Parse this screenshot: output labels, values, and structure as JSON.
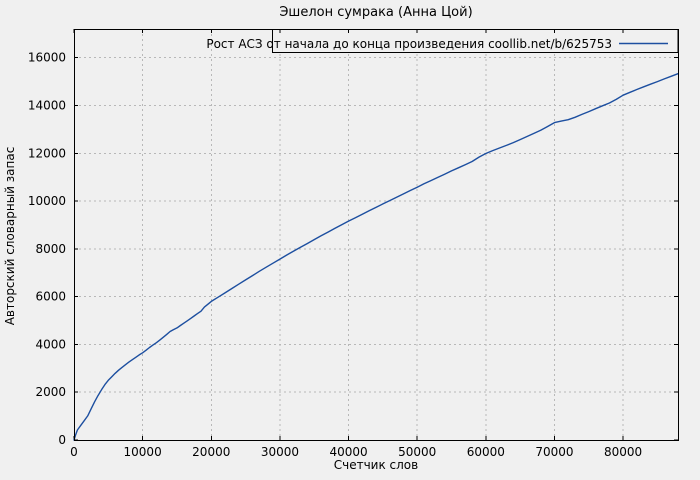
{
  "chart_data": {
    "type": "line",
    "title": "Эшелон сумрака (Анна Цой)",
    "xlabel": "Счетчик слов",
    "ylabel": "Авторский словарный запас",
    "legend": {
      "label": "Рост АСЗ от начала до конца произведения coollib.net/b/625753",
      "position": "top-right",
      "box": true
    },
    "grid": true,
    "xlim": [
      0,
      88000
    ],
    "ylim": [
      0,
      17200
    ],
    "xticks": [
      0,
      10000,
      20000,
      30000,
      40000,
      50000,
      60000,
      70000,
      80000
    ],
    "yticks": [
      0,
      2000,
      4000,
      6000,
      8000,
      10000,
      12000,
      14000,
      16000
    ],
    "colors": {
      "line": "#1d4fa0",
      "background": "#f0f0f0",
      "grid": "#b8b8b8",
      "border": "#000000",
      "text": "#000000"
    },
    "series": [
      {
        "name": "Рост АСЗ от начала до конца произведения coollib.net/b/625753",
        "color": "#1d4fa0",
        "points": [
          [
            0,
            0
          ],
          [
            200,
            190
          ],
          [
            500,
            420
          ],
          [
            1000,
            620
          ],
          [
            1500,
            810
          ],
          [
            2000,
            1010
          ],
          [
            2500,
            1310
          ],
          [
            3000,
            1600
          ],
          [
            3500,
            1860
          ],
          [
            4000,
            2100
          ],
          [
            4500,
            2320
          ],
          [
            5000,
            2500
          ],
          [
            5500,
            2650
          ],
          [
            6000,
            2790
          ],
          [
            6500,
            2920
          ],
          [
            7000,
            3040
          ],
          [
            7500,
            3150
          ],
          [
            8000,
            3260
          ],
          [
            8500,
            3360
          ],
          [
            9000,
            3460
          ],
          [
            9500,
            3560
          ],
          [
            10000,
            3650
          ],
          [
            10500,
            3760
          ],
          [
            11000,
            3870
          ],
          [
            11500,
            3970
          ],
          [
            12000,
            4070
          ],
          [
            12500,
            4180
          ],
          [
            13000,
            4300
          ],
          [
            13500,
            4420
          ],
          [
            14000,
            4540
          ],
          [
            14500,
            4620
          ],
          [
            15000,
            4690
          ],
          [
            15500,
            4790
          ],
          [
            16000,
            4890
          ],
          [
            16500,
            4990
          ],
          [
            17000,
            5090
          ],
          [
            17500,
            5190
          ],
          [
            18000,
            5290
          ],
          [
            18500,
            5390
          ],
          [
            19000,
            5560
          ],
          [
            19500,
            5680
          ],
          [
            20000,
            5800
          ],
          [
            21000,
            5975
          ],
          [
            22000,
            6155
          ],
          [
            23000,
            6340
          ],
          [
            24000,
            6520
          ],
          [
            25000,
            6700
          ],
          [
            26000,
            6880
          ],
          [
            27000,
            7060
          ],
          [
            28000,
            7230
          ],
          [
            29000,
            7400
          ],
          [
            30000,
            7570
          ],
          [
            31000,
            7740
          ],
          [
            32000,
            7905
          ],
          [
            33000,
            8065
          ],
          [
            34000,
            8225
          ],
          [
            35000,
            8385
          ],
          [
            36000,
            8545
          ],
          [
            37000,
            8700
          ],
          [
            38000,
            8855
          ],
          [
            39000,
            9010
          ],
          [
            40000,
            9160
          ],
          [
            41000,
            9300
          ],
          [
            42000,
            9445
          ],
          [
            43000,
            9590
          ],
          [
            44000,
            9735
          ],
          [
            45000,
            9880
          ],
          [
            46000,
            10020
          ],
          [
            47000,
            10160
          ],
          [
            48000,
            10300
          ],
          [
            49000,
            10440
          ],
          [
            50000,
            10580
          ],
          [
            51000,
            10720
          ],
          [
            52000,
            10855
          ],
          [
            53000,
            10990
          ],
          [
            54000,
            11125
          ],
          [
            55000,
            11260
          ],
          [
            56000,
            11390
          ],
          [
            57000,
            11520
          ],
          [
            58000,
            11655
          ],
          [
            59000,
            11840
          ],
          [
            60000,
            11990
          ],
          [
            61000,
            12110
          ],
          [
            62000,
            12220
          ],
          [
            63000,
            12330
          ],
          [
            64000,
            12445
          ],
          [
            65000,
            12570
          ],
          [
            66000,
            12700
          ],
          [
            67000,
            12830
          ],
          [
            68000,
            12960
          ],
          [
            69000,
            13120
          ],
          [
            70000,
            13285
          ],
          [
            71000,
            13345
          ],
          [
            72000,
            13405
          ],
          [
            73000,
            13505
          ],
          [
            74000,
            13625
          ],
          [
            75000,
            13745
          ],
          [
            76000,
            13865
          ],
          [
            77000,
            13985
          ],
          [
            78000,
            14105
          ],
          [
            79000,
            14255
          ],
          [
            80000,
            14430
          ],
          [
            81000,
            14550
          ],
          [
            82000,
            14670
          ],
          [
            83000,
            14780
          ],
          [
            84000,
            14890
          ],
          [
            85000,
            15000
          ],
          [
            86000,
            15110
          ],
          [
            87000,
            15220
          ],
          [
            88000,
            15330
          ]
        ]
      }
    ]
  }
}
